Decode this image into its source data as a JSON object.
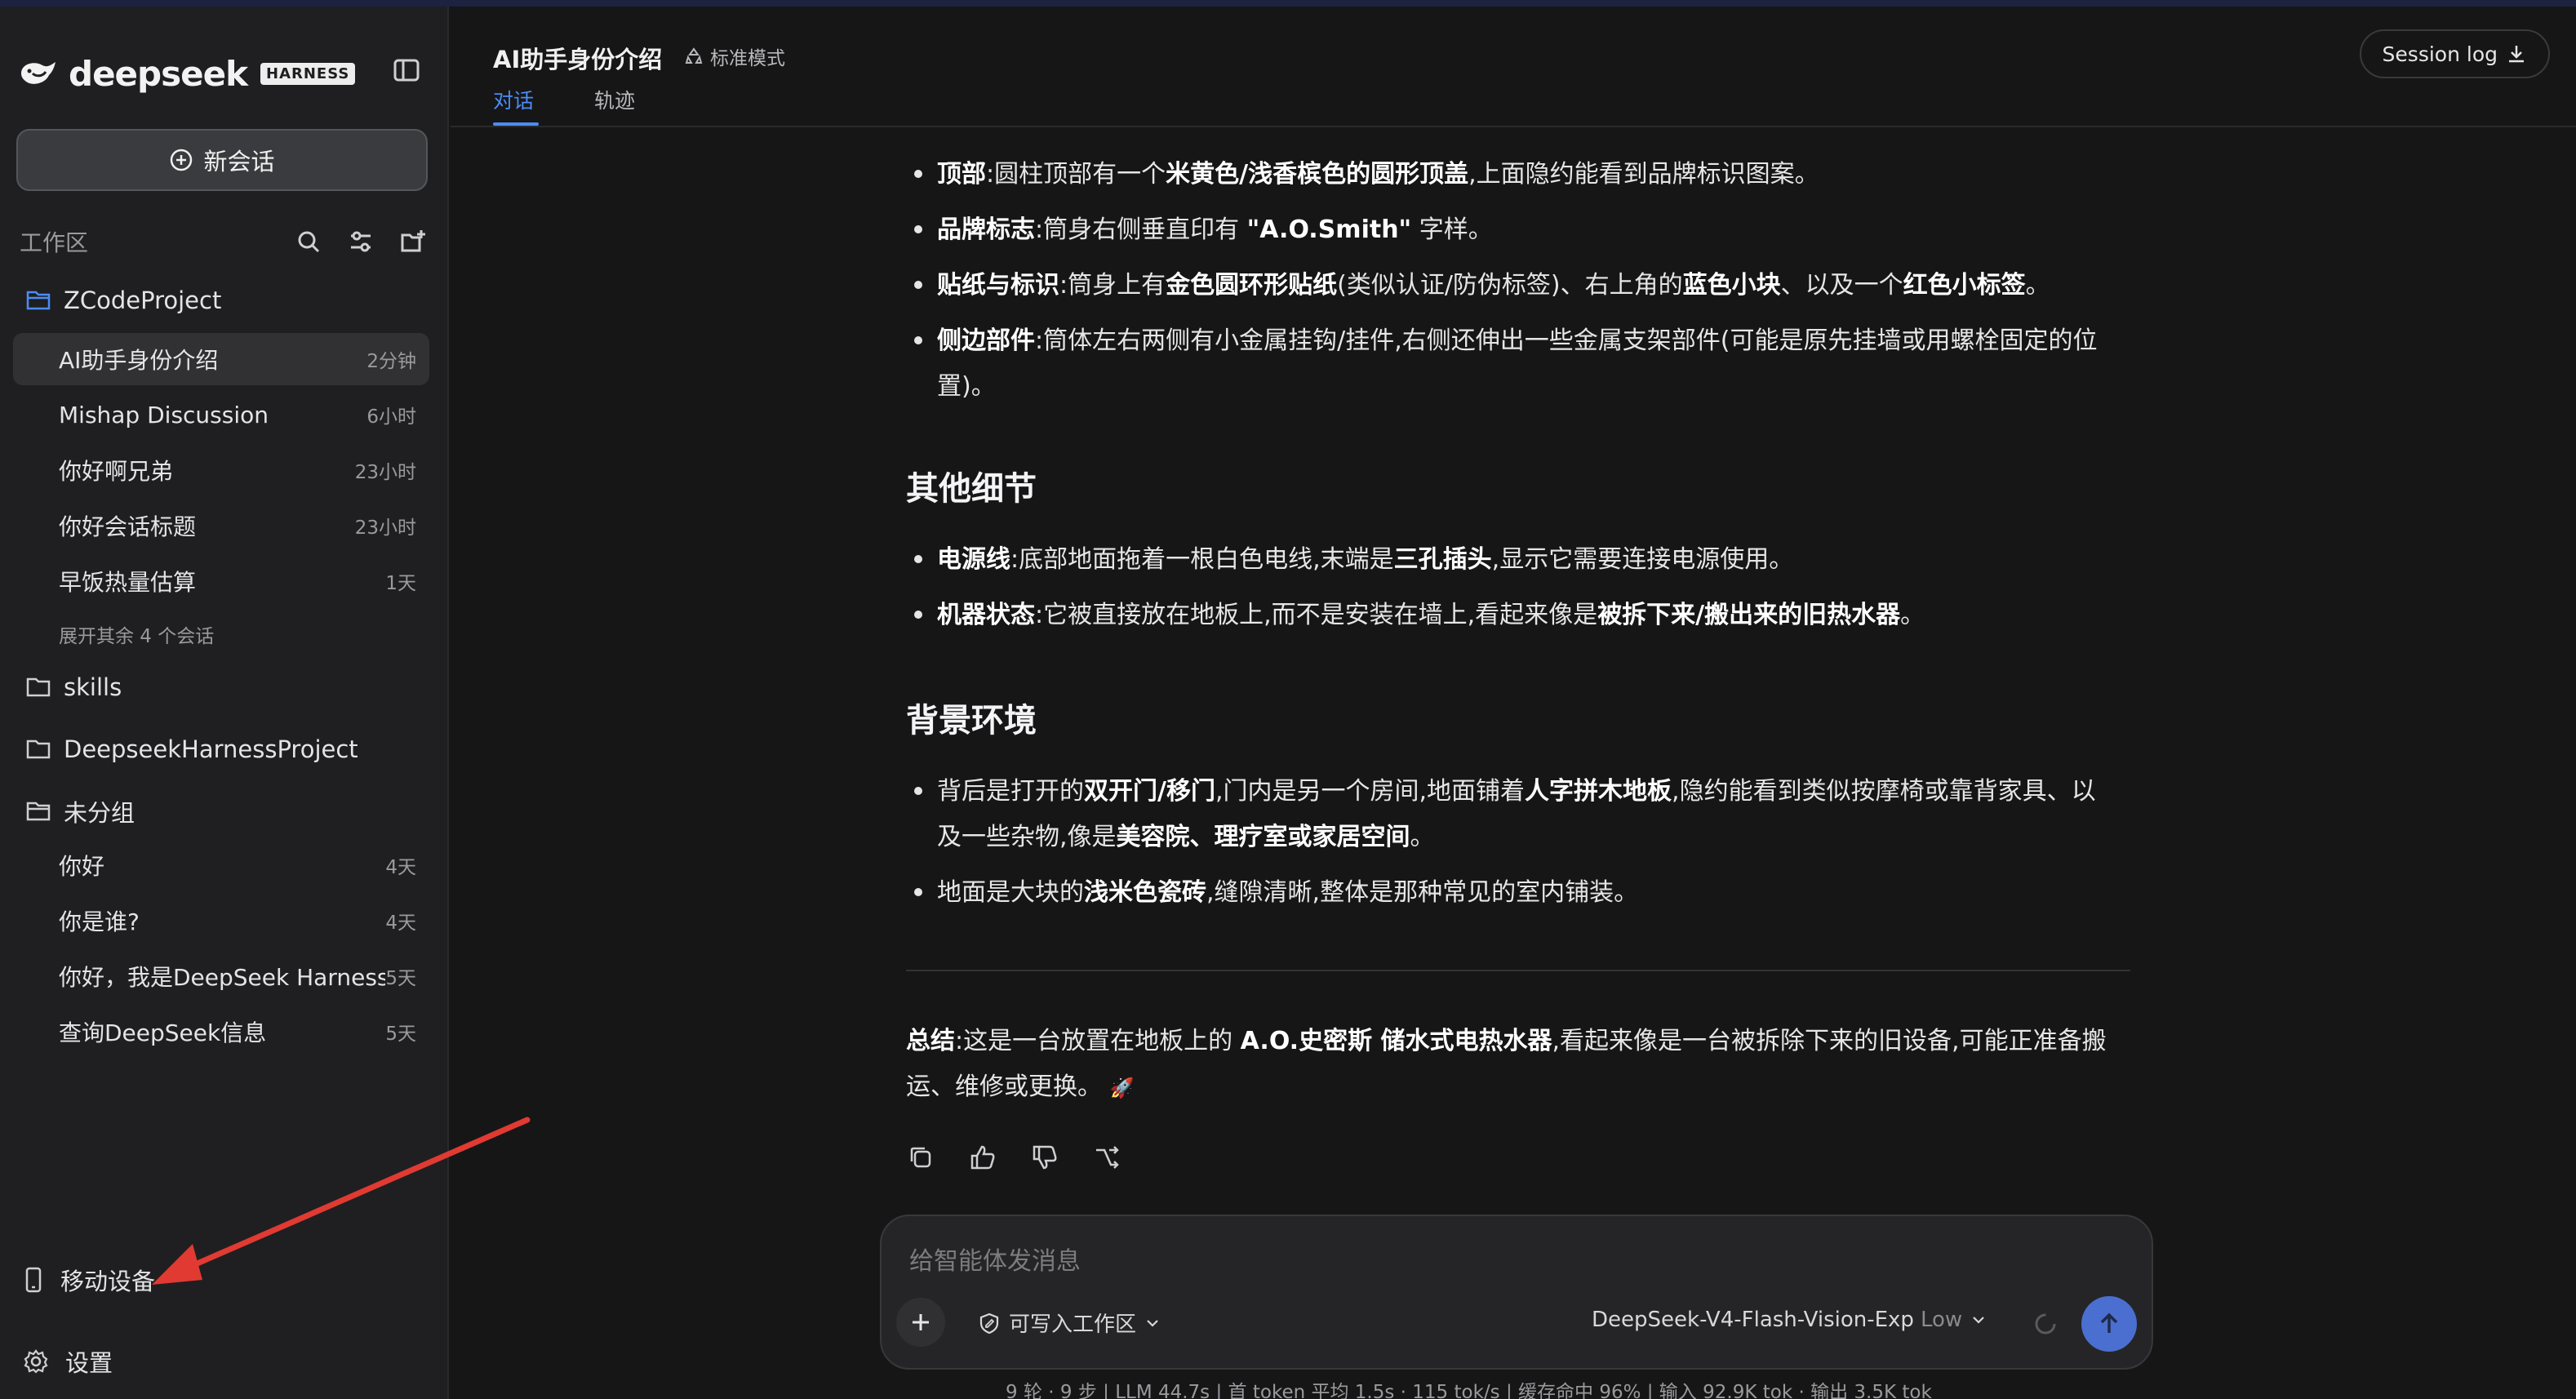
{
  "brand": {
    "name": "deepseek",
    "badge": "HARNESS"
  },
  "sidebar": {
    "new_chat_label": "新会话",
    "workspace_title": "工作区",
    "folders": [
      {
        "name": "ZCodeProject"
      },
      {
        "name": "skills"
      },
      {
        "name": "DeepseekHarnessProject"
      },
      {
        "name": "未分组"
      }
    ],
    "zcode_items": [
      {
        "name": "AI助手身份介绍",
        "time": "2分钟",
        "active": true
      },
      {
        "name": "Mishap Discussion",
        "time": "6小时"
      },
      {
        "name": "你好啊兄弟",
        "time": "23小时"
      },
      {
        "name": "你好会话标题",
        "time": "23小时"
      },
      {
        "name": "早饭热量估算",
        "time": "1天"
      }
    ],
    "expand_more": "展开其余 4 个会话",
    "ungrouped_items": [
      {
        "name": "你好",
        "time": "4天"
      },
      {
        "name": "你是谁?",
        "time": "4天"
      },
      {
        "name": "你好，我是DeepSeek Harness",
        "time": "5天"
      },
      {
        "name": "查询DeepSeek信息",
        "time": "5天"
      }
    ],
    "mobile_device": "移动设备",
    "settings": "设置"
  },
  "header": {
    "title": "AI助手身份介绍",
    "mode": "标准模式",
    "tabs": [
      {
        "label": "对话"
      },
      {
        "label": "轨迹"
      }
    ],
    "session_log": "Session log"
  },
  "content": {
    "bullets_top": [
      {
        "parts": [
          [
            "b",
            "顶部"
          ],
          [
            "t",
            ":圆柱顶部有一个"
          ],
          [
            "b",
            "米黄色/浅香槟色的圆形顶盖"
          ],
          [
            "t",
            ",上面隐约能看到品牌标识图案。"
          ]
        ]
      },
      {
        "parts": [
          [
            "b",
            "品牌标志"
          ],
          [
            "t",
            ":筒身右侧垂直印有 "
          ],
          [
            "b",
            "\"A.O.Smith\""
          ],
          [
            "t",
            " 字样。"
          ]
        ]
      },
      {
        "parts": [
          [
            "b",
            "贴纸与标识"
          ],
          [
            "t",
            ":筒身上有"
          ],
          [
            "b",
            "金色圆环形贴纸"
          ],
          [
            "t",
            "(类似认证/防伪标签)、右上角的"
          ],
          [
            "b",
            "蓝色小块"
          ],
          [
            "t",
            "、以及一个"
          ],
          [
            "b",
            "红色小标签"
          ],
          [
            "t",
            "。"
          ]
        ]
      },
      {
        "parts": [
          [
            "b",
            "侧边部件"
          ],
          [
            "t",
            ":筒体左右两侧有小金属挂钩/挂件,右侧还伸出一些金属支架部件(可能是原先挂墙或用螺栓固定的位置)。"
          ]
        ]
      }
    ],
    "h2_details": "其他细节",
    "bullets_details": [
      {
        "parts": [
          [
            "b",
            "电源线"
          ],
          [
            "t",
            ":底部地面拖着一根白色电线,末端是"
          ],
          [
            "b",
            "三孔插头"
          ],
          [
            "t",
            ",显示它需要连接电源使用。"
          ]
        ]
      },
      {
        "parts": [
          [
            "b",
            "机器状态"
          ],
          [
            "t",
            ":它被直接放在地板上,而不是安装在墙上,看起来像是"
          ],
          [
            "b",
            "被拆下来/搬出来的旧热水器"
          ],
          [
            "t",
            "。"
          ]
        ]
      }
    ],
    "h2_background": "背景环境",
    "bullets_background": [
      {
        "parts": [
          [
            "t",
            "背后是打开的"
          ],
          [
            "b",
            "双开门/移门"
          ],
          [
            "t",
            ",门内是另一个房间,地面铺着"
          ],
          [
            "b",
            "人字拼木地板"
          ],
          [
            "t",
            ",隐约能看到类似按摩椅或靠背家具、以及一些杂物,像是"
          ],
          [
            "b",
            "美容院、理疗室或家居空间"
          ],
          [
            "t",
            "。"
          ]
        ]
      },
      {
        "parts": [
          [
            "t",
            "地面是大块的"
          ],
          [
            "b",
            "浅米色瓷砖"
          ],
          [
            "t",
            ",缝隙清晰,整体是那种常见的室内铺装。"
          ]
        ]
      }
    ],
    "summary": {
      "parts": [
        [
          "b",
          "总结"
        ],
        [
          "t",
          ":这是一台放置在地板上的 "
        ],
        [
          "b",
          "A.O.史密斯 储水式电热水器"
        ],
        [
          "t",
          ",看起来像是一台被拆除下来的旧设备,可能正准备搬运、维修或更换。"
        ]
      ]
    }
  },
  "composer": {
    "placeholder": "给智能体发消息",
    "workspace_perm": "可写入工作区",
    "model": "DeepSeek-V4-Flash-Vision-Exp",
    "effort": "Low"
  },
  "stats": "9 轮 · 9 步  |  LLM 44.7s  |  首 token 平均 1.5s · 115 tok/s  |  缓存命中 96%  |  输入 92.9K tok · 输出 3.5K tok"
}
